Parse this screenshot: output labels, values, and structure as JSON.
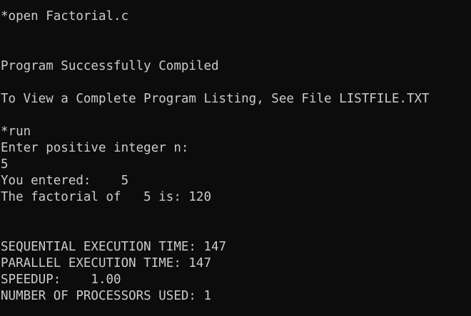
{
  "terminal": {
    "lines": [
      "*open Factorial.c",
      "Program Successfully Compiled",
      "To View a Complete Program Listing, See File LISTFILE.TXT",
      "*run",
      "Enter positive integer n:",
      "5",
      "You entered:    5",
      "The factorial of   5 is: 120",
      "SEQUENTIAL EXECUTION TIME: 147",
      "PARALLEL EXECUTION TIME: 147",
      "SPEEDUP:    1.00",
      "NUMBER OF PROCESSORS USED: 1"
    ]
  },
  "colors": {
    "background": "#0c0c0c",
    "foreground": "#cccccc"
  }
}
